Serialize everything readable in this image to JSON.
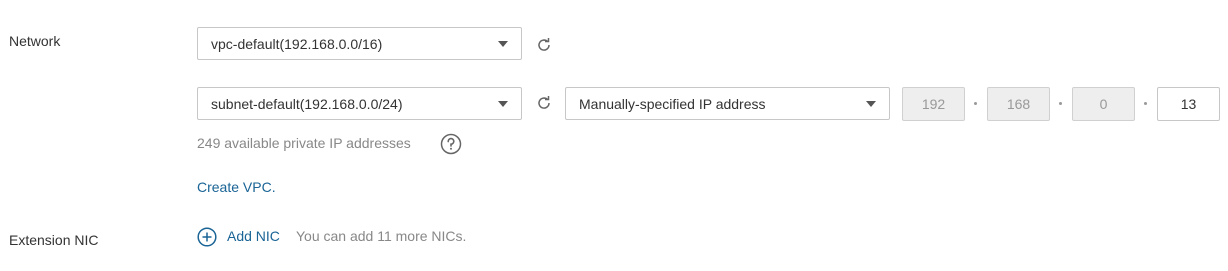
{
  "network": {
    "label": "Network",
    "vpc_select": {
      "value": "vpc-default(192.168.0.0/16)"
    },
    "subnet_select": {
      "value": "subnet-default(192.168.0.0/24)"
    },
    "ip_mode_select": {
      "value": "Manually-specified IP address"
    },
    "ip_octets": [
      "192",
      "168",
      "0",
      "13"
    ],
    "available_ips_text": "249 available private IP addresses",
    "create_vpc_link": "Create VPC."
  },
  "extension_nic": {
    "label": "Extension NIC",
    "add_nic_label": "Add NIC",
    "add_nic_hint": "You can add 11 more NICs."
  },
  "icons": {
    "refresh": "refresh-icon",
    "dropdown": "chevron-down-icon",
    "help": "question-icon",
    "add": "plus-circle-icon"
  },
  "colors": {
    "link": "#1a6496",
    "border": "#c7c7c7",
    "disabled_bg": "#eeeeee",
    "muted_text": "#888888"
  }
}
